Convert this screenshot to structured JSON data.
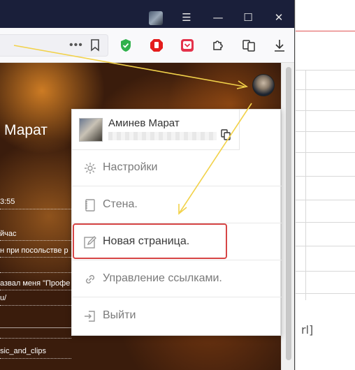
{
  "user": {
    "name": "Аминев Марат"
  },
  "profile": {
    "name_partial": "Марат"
  },
  "content_texts": [
    "3:55",
    "йчас",
    "н при посольстве р",
    "азвал меня \"Профе",
    "u/",
    "sic_and_clips"
  ],
  "menu": {
    "items": [
      {
        "label": "Настройки",
        "icon": "gear-icon"
      },
      {
        "label": "Стена.",
        "icon": "notebook-icon"
      },
      {
        "label": "Новая страница.",
        "icon": "pencil-icon"
      },
      {
        "label": "Управление ссылками.",
        "icon": "link-icon"
      },
      {
        "label": "Выйти",
        "icon": "logout-icon"
      }
    ]
  },
  "background_page": {
    "text": "rl]"
  },
  "colors": {
    "highlight": "#d64545",
    "arrow": "#f2d24a",
    "titlebar": "#1a1f3a"
  }
}
